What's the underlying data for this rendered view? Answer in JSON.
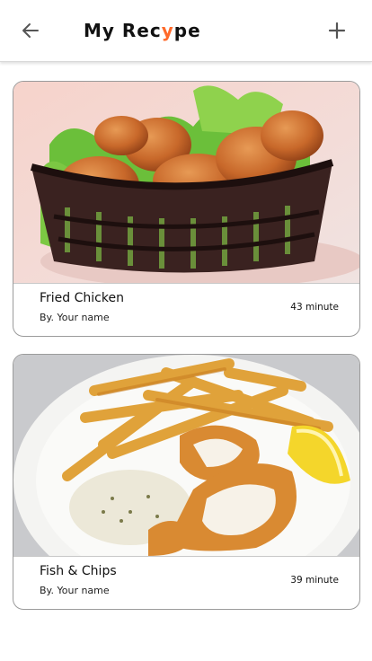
{
  "header": {
    "title_prefix": "My Rec",
    "title_accent": "y",
    "title_suffix": "pe",
    "accent_color": "#ff6a2a",
    "back_icon": "arrow-left-icon",
    "add_icon": "plus-icon"
  },
  "recipes": [
    {
      "name": "Fried Chicken",
      "author": "By. Your name",
      "time": "43 minute",
      "image": "fried-chicken-basket"
    },
    {
      "name": "Fish & Chips",
      "author": "By. Your name",
      "time": "39 minute",
      "image": "fish-and-chips-plate"
    }
  ]
}
